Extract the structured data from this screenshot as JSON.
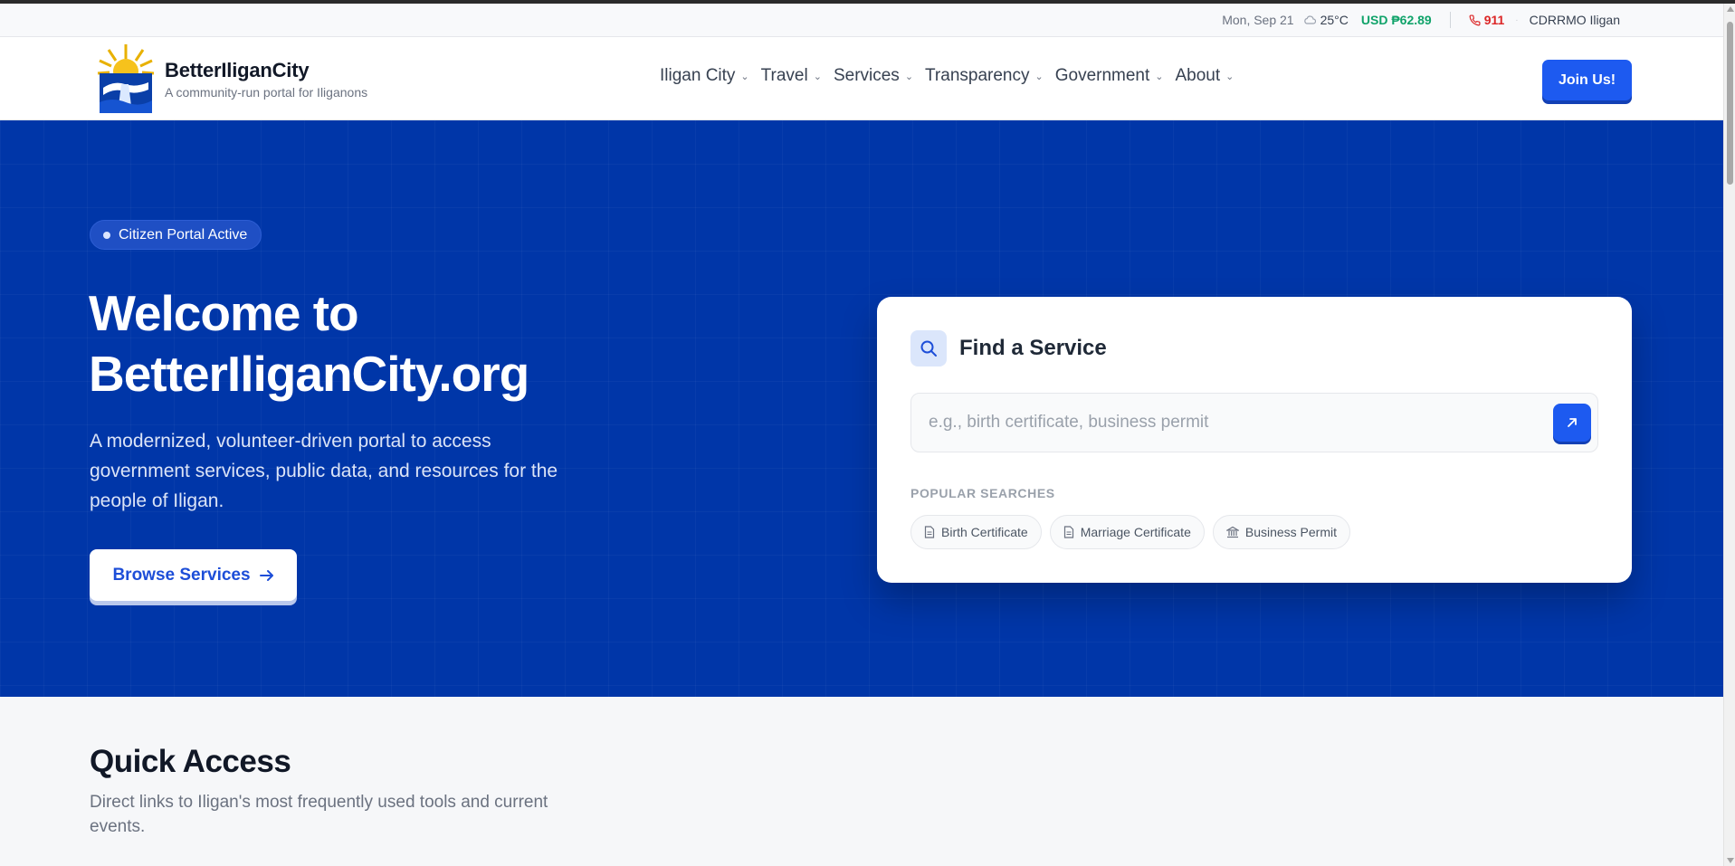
{
  "utility_bar": {
    "date": "Mon, Sep 21",
    "weather_icon": "cloud-icon",
    "temperature": "25°C",
    "exchange_rate": "USD ₱62.89",
    "emergency_icon": "phone-icon",
    "emergency_number": "911",
    "agency": "CDRRMO Iligan"
  },
  "header": {
    "brand_name": "BetterIliganCity",
    "brand_tagline": "A community-run portal for Iliganons",
    "nav": [
      {
        "label": "Iligan City"
      },
      {
        "label": "Travel"
      },
      {
        "label": "Services"
      },
      {
        "label": "Transparency"
      },
      {
        "label": "Government"
      },
      {
        "label": "About"
      }
    ],
    "join_label": "Join Us!"
  },
  "hero": {
    "badge": "Citizen Portal Active",
    "title_line1": "Welcome to",
    "title_line2": "BetterIliganCity.org",
    "description": "A modernized, volunteer-driven portal to access government services, public data, and resources for the people of Iligan.",
    "browse_label": "Browse Services"
  },
  "find_service": {
    "title": "Find a Service",
    "search_placeholder": "e.g., birth certificate, business permit",
    "popular_label": "POPULAR SEARCHES",
    "chips": [
      {
        "label": "Birth Certificate",
        "icon": "document-icon"
      },
      {
        "label": "Marriage Certificate",
        "icon": "document-icon"
      },
      {
        "label": "Business Permit",
        "icon": "building-icon"
      }
    ]
  },
  "quick_access": {
    "title": "Quick Access",
    "description": "Direct links to Iligan's most frequently used tools and current events."
  },
  "colors": {
    "hero_bg": "#0036a8",
    "accent": "#1d5af0",
    "usd_green": "#10a36a",
    "emergency_red": "#dc2626"
  }
}
